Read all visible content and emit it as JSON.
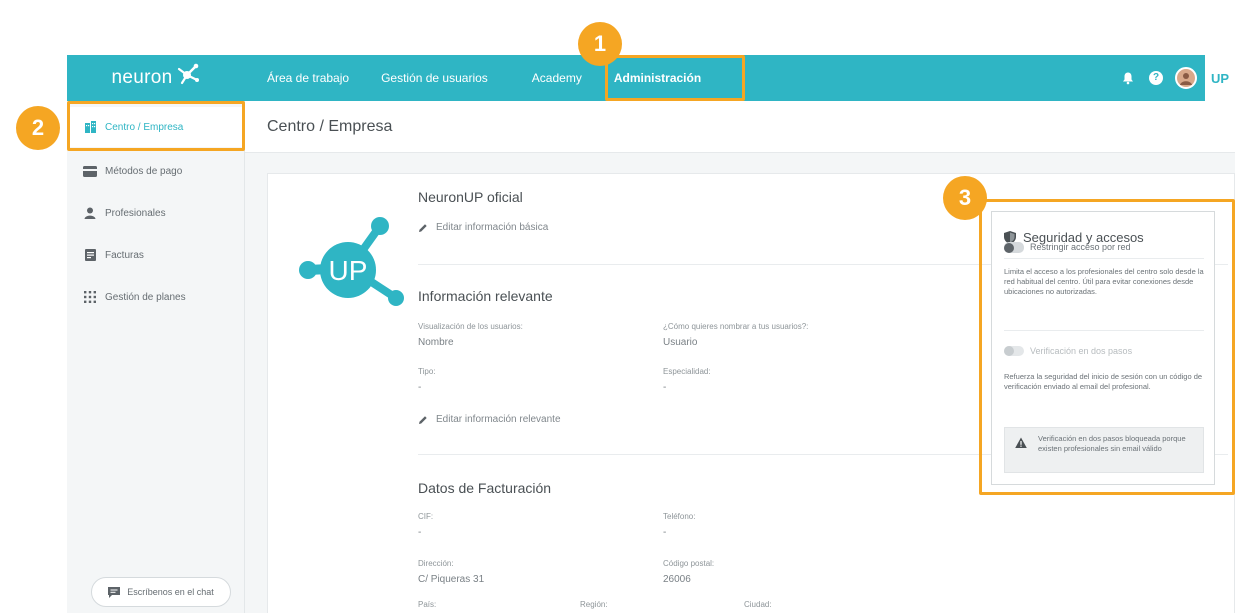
{
  "brand": {
    "name": "neuron"
  },
  "nav": {
    "items": [
      {
        "label": "Área de trabajo"
      },
      {
        "label": "Gestión de usuarios"
      },
      {
        "label": "Academy"
      },
      {
        "label": "Administración"
      }
    ],
    "up_label": "UP"
  },
  "sidebar": {
    "items": [
      {
        "label": "Centro / Empresa"
      },
      {
        "label": "Métodos de pago"
      },
      {
        "label": "Profesionales"
      },
      {
        "label": "Facturas"
      },
      {
        "label": "Gestión de planes"
      }
    ],
    "chat_label": "Escríbenos en el chat"
  },
  "page": {
    "title": "Centro / Empresa"
  },
  "center": {
    "logo_text": "UP",
    "name": "NeuronUP oficial",
    "edit_basic": "Editar información básica",
    "relevant": {
      "title": "Información relevante",
      "fields": [
        {
          "label": "Visualización de los usuarios:",
          "value": "Nombre"
        },
        {
          "label": "¿Cómo quieres nombrar a tus usuarios?:",
          "value": "Usuario"
        },
        {
          "label": "Tipo:",
          "value": "-"
        },
        {
          "label": "Especialidad:",
          "value": "-"
        }
      ],
      "edit": "Editar información relevante"
    },
    "billing": {
      "title": "Datos de Facturación",
      "fields": [
        {
          "label": "CIF:",
          "value": "-"
        },
        {
          "label": "Teléfono:",
          "value": "-"
        },
        {
          "label": "Dirección:",
          "value": "C/ Piqueras 31"
        },
        {
          "label": "Código postal:",
          "value": "26006"
        },
        {
          "label": "País:",
          "value": ""
        },
        {
          "label": "Región:",
          "value": ""
        },
        {
          "label": "Ciudad:",
          "value": ""
        }
      ]
    }
  },
  "security": {
    "title": "Seguridad y accesos",
    "network": {
      "label": "Restringir acceso por red",
      "description": "Limita el acceso a los profesionales del centro solo desde la red habitual del centro. Útil para evitar conexiones desde ubicaciones no autorizadas."
    },
    "two_step": {
      "label": "Verificación en dos pasos",
      "description": "Refuerza la seguridad del inicio de sesión con un código de verificación enviado al email del profesional."
    },
    "warning": "Verificación en dos pasos bloqueada porque existen profesionales sin email válido"
  },
  "annotations": {
    "badge1": "1",
    "badge2": "2",
    "badge3": "3"
  },
  "colors": {
    "brand": "#2fb5c4",
    "highlight": "#f5a623"
  }
}
